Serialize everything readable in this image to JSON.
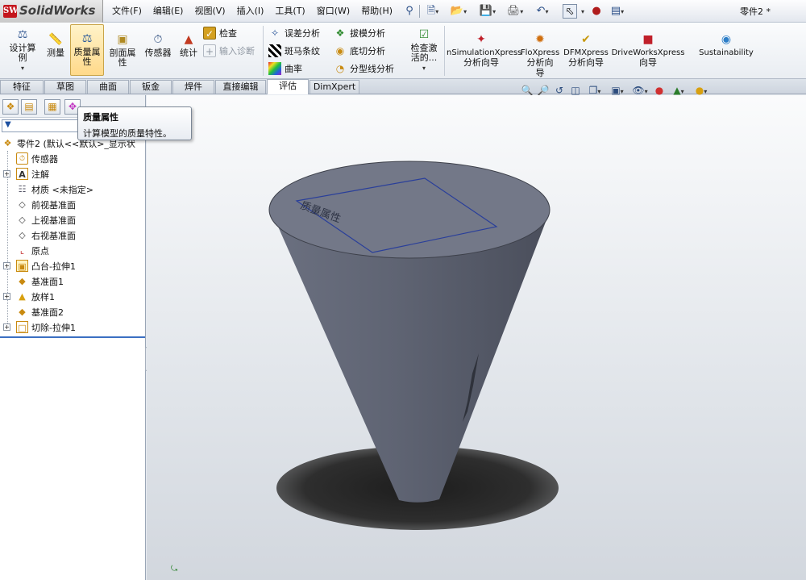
{
  "app": {
    "name": "SolidWorks",
    "logo_badge": "SW",
    "document_title": "零件2 *"
  },
  "menu": [
    "文件(F)",
    "编辑(E)",
    "视图(V)",
    "插入(I)",
    "工具(T)",
    "窗口(W)",
    "帮助(H)"
  ],
  "ribbon": {
    "design_study": {
      "label1": "设计算",
      "label2": "例"
    },
    "measure": "测量",
    "mass_properties": {
      "label1": "质量属",
      "label2": "性"
    },
    "section_properties": {
      "label1": "剖面属",
      "label2": "性"
    },
    "sensor": "传感器",
    "statistics": "统计",
    "check": "检查",
    "import_diagnostics": "输入诊断",
    "deviation_analysis": "误差分析",
    "zebra_stripes": "斑马条纹",
    "curvature": "曲率",
    "draft_analysis": "拔模分析",
    "undercut_analysis": "底切分析",
    "parting_line_analysis": "分型线分析",
    "check_active": {
      "label1": "检查激",
      "label2": "活的..."
    },
    "simulation_xpress": {
      "label1": "nSimulationXpress",
      "label2": "分析向导"
    },
    "flo_xpress": {
      "label1": "FloXpress",
      "label2": "分析向",
      "label3": "导"
    },
    "dfm_xpress": {
      "label1": "DFMXpress",
      "label2": "分析向导"
    },
    "driveworks_xpress": {
      "label1": "DriveWorksXpress",
      "label2": "向导"
    },
    "sustainability": "Sustainability"
  },
  "tabs": [
    "特征",
    "草图",
    "曲面",
    "钣金",
    "焊件",
    "直接编辑",
    "评估",
    "DimXpert"
  ],
  "selected_tab": "评估",
  "tooltip": {
    "title": "质量属性",
    "description": "计算模型的质量特性。"
  },
  "tree": {
    "root": "零件2  (默认<<默认>_显示状",
    "items": [
      "传感器",
      "注解",
      "材质 <未指定>",
      "前视基准面",
      "上视基准面",
      "右视基准面",
      "原点",
      "凸台-拉伸1",
      "基准面1",
      "放样1",
      "基准面2",
      "切除-拉伸1"
    ]
  },
  "model": {
    "face_text": "质量属性",
    "body_color": "#5f6473",
    "shadow_color": "#262626"
  },
  "colors": {
    "accent": "#3b6fc2",
    "ribbon_highlight": "#ffd98a",
    "brand_red": "#c4161c"
  }
}
